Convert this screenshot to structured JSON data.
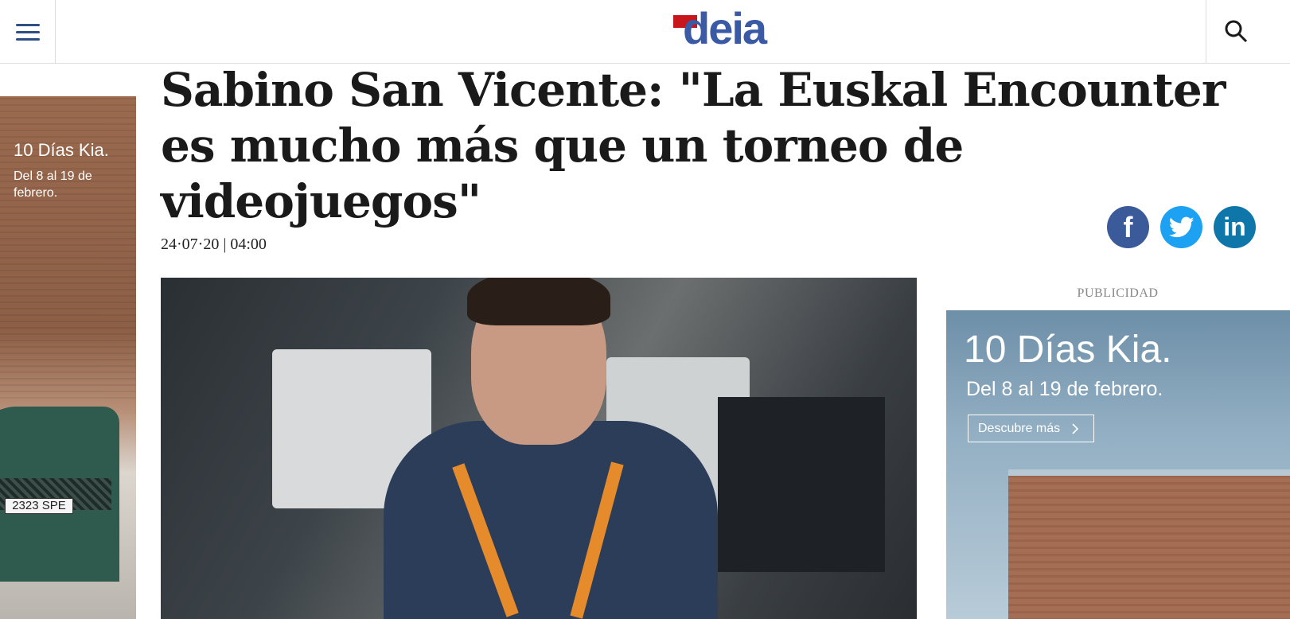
{
  "header": {
    "logo_text": "deia",
    "menu_icon": "hamburger-menu-icon",
    "search_icon": "search-icon",
    "brand_color": "#3a5aa6",
    "logo_accent": "#c8161d"
  },
  "article": {
    "headline": "Sabino San Vicente: \"La Euskal Encounter es mucho más que un torneo de videojuegos\"",
    "date": "24·07·20 | 04:00"
  },
  "share": {
    "facebook_label": "f",
    "linkedin_label": "in",
    "facebook_color": "#3b5a9a",
    "twitter_color": "#1da1f2",
    "linkedin_color": "#0e76a8"
  },
  "left_ad": {
    "title": "10 Días Kia.",
    "subtitle": "Del 8 al 19 de febrero.",
    "plate": "2323 SPE"
  },
  "right_ad": {
    "label": "PUBLICIDAD",
    "title": "10 Días Kia.",
    "subtitle": "Del 8 al 19 de febrero.",
    "cta": "Descubre más",
    "cta_icon": "chevron-right-icon"
  }
}
